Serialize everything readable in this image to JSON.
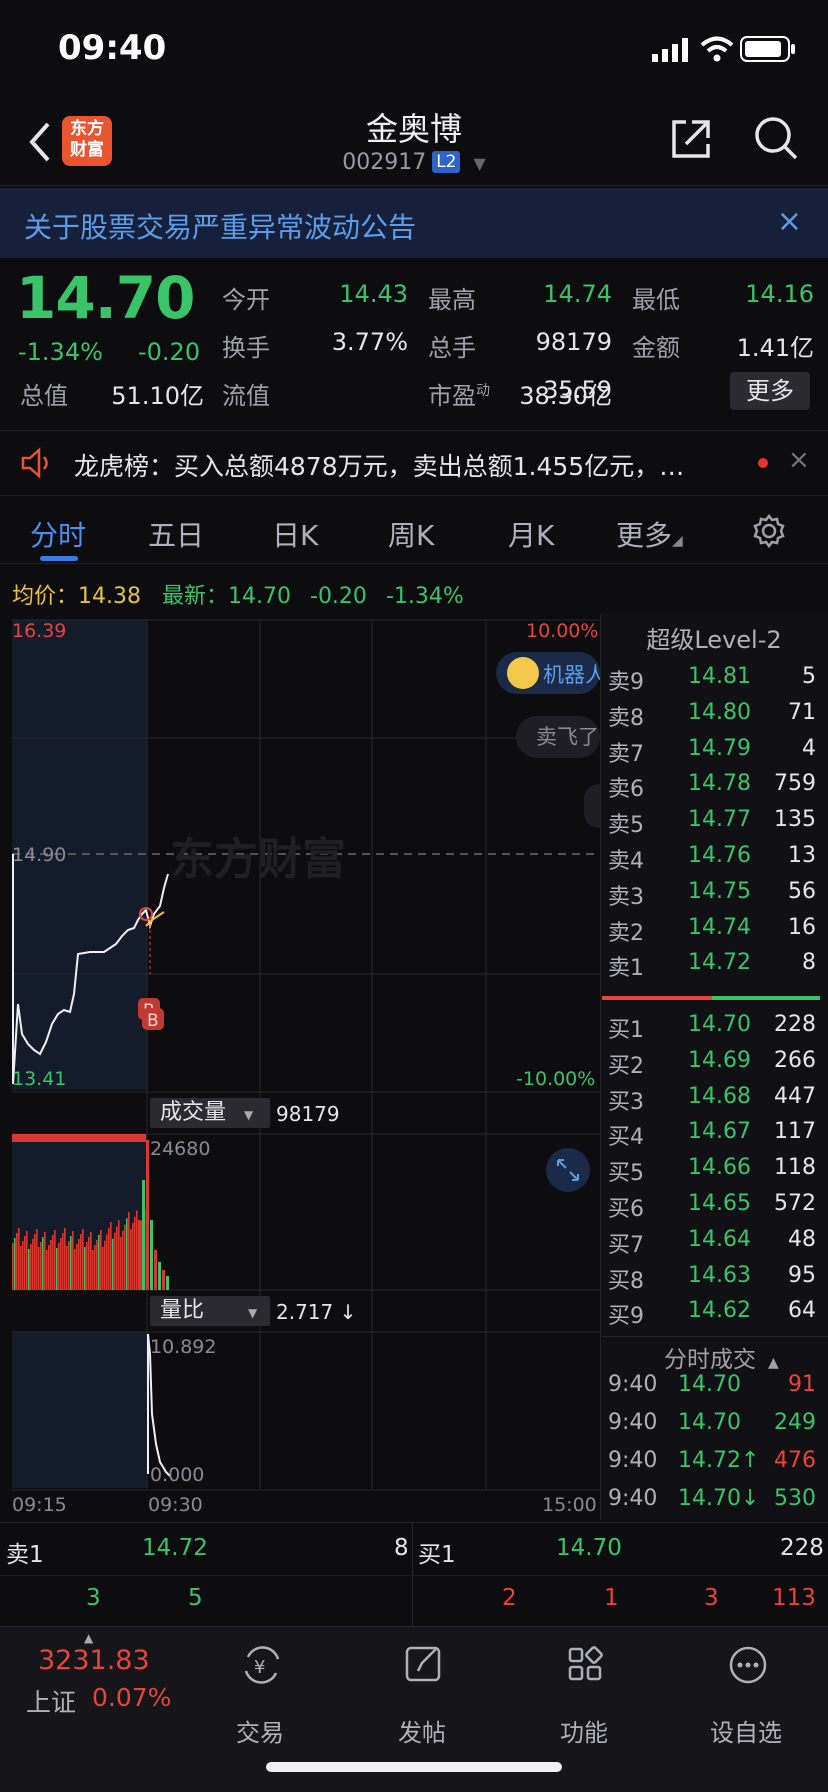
{
  "status": {
    "time": "09:40"
  },
  "header": {
    "logo_text_1": "东方",
    "logo_text_2": "财富",
    "stock_name": "金奥博",
    "stock_code": "002917",
    "level_badge": "L2"
  },
  "notice": {
    "text": "关于股票交易严重异常波动公告",
    "close": "×"
  },
  "quote": {
    "price": "14.70",
    "change_pct": "-1.34%",
    "change_abs": "-0.20",
    "fields": [
      {
        "label": "今开",
        "value": "14.43",
        "color": "green"
      },
      {
        "label": "最高",
        "value": "14.74",
        "color": "green"
      },
      {
        "label": "最低",
        "value": "14.16",
        "color": "green"
      },
      {
        "label": "换手",
        "value": "3.77%",
        "color": "white"
      },
      {
        "label": "总手",
        "value": "98179",
        "color": "white"
      },
      {
        "label": "金额",
        "value": "1.41亿",
        "color": "white"
      },
      {
        "label": "总值",
        "value": "51.10亿",
        "color": "white"
      },
      {
        "label": "流值",
        "value": "38.30亿",
        "color": "white"
      },
      {
        "label": "市盈",
        "label_sup": "动",
        "value": "35.59",
        "color": "white"
      }
    ],
    "more_button": "更多"
  },
  "lhb": {
    "text": "龙虎榜：买入总额4878万元，卖出总额1.455亿元，…"
  },
  "tabs": [
    "分时",
    "五日",
    "日K",
    "周K",
    "月K",
    "更多"
  ],
  "avg_line": {
    "avg_label": "均价：",
    "avg_value": "14.38",
    "latest_label": "最新：",
    "latest_value": "14.70",
    "change_abs": "-0.20",
    "change_pct": "-1.34%"
  },
  "chart": {
    "price_top": "16.39",
    "price_bottom": "13.41",
    "price_mid": "14.90",
    "pct_top": "10.00%",
    "pct_bottom": "-10.00%",
    "watermark": "东方财富",
    "robot_label": "机器人",
    "float_btn": "卖飞了",
    "volume_tag": "成交量",
    "volume_value": "98179",
    "volume_max": "24680",
    "ratio_tag": "量比",
    "ratio_value": "2.717 ↓",
    "ratio_max": "10.892",
    "ratio_min": "0.000",
    "time_start": "09:15",
    "time_open": "09:30",
    "time_end": "15:00",
    "marker_b": "B"
  },
  "orderbook": {
    "title": "超级Level-2",
    "asks": [
      {
        "label": "卖9",
        "price": "14.81",
        "vol": "5"
      },
      {
        "label": "卖8",
        "price": "14.80",
        "vol": "71"
      },
      {
        "label": "卖7",
        "price": "14.79",
        "vol": "4"
      },
      {
        "label": "卖6",
        "price": "14.78",
        "vol": "759"
      },
      {
        "label": "卖5",
        "price": "14.77",
        "vol": "135"
      },
      {
        "label": "卖4",
        "price": "14.76",
        "vol": "13"
      },
      {
        "label": "卖3",
        "price": "14.75",
        "vol": "56"
      },
      {
        "label": "卖2",
        "price": "14.74",
        "vol": "16"
      },
      {
        "label": "卖1",
        "price": "14.72",
        "vol": "8"
      }
    ],
    "bids": [
      {
        "label": "买1",
        "price": "14.70",
        "vol": "228"
      },
      {
        "label": "买2",
        "price": "14.69",
        "vol": "266"
      },
      {
        "label": "买3",
        "price": "14.68",
        "vol": "447"
      },
      {
        "label": "买4",
        "price": "14.67",
        "vol": "117"
      },
      {
        "label": "买5",
        "price": "14.66",
        "vol": "118"
      },
      {
        "label": "买6",
        "price": "14.65",
        "vol": "572"
      },
      {
        "label": "买7",
        "price": "14.64",
        "vol": "48"
      },
      {
        "label": "买8",
        "price": "14.63",
        "vol": "95"
      },
      {
        "label": "买9",
        "price": "14.62",
        "vol": "64"
      }
    ],
    "trades_title": "分时成交",
    "trades": [
      {
        "time": "9:40",
        "price": "14.70",
        "vol": "91",
        "vol_color": "red"
      },
      {
        "time": "9:40",
        "price": "14.70",
        "vol": "249",
        "vol_color": "green"
      },
      {
        "time": "9:40",
        "price": "14.72↑",
        "vol": "476",
        "vol_color": "red"
      },
      {
        "time": "9:40",
        "price": "14.70↓",
        "vol": "530",
        "vol_color": "green"
      }
    ]
  },
  "strip": {
    "sell_label": "卖1",
    "sell_price": "14.72",
    "sell_vol": "8",
    "buy_label": "买1",
    "buy_price": "14.70",
    "buy_vol": "228",
    "sell_sub": [
      "3",
      "5"
    ],
    "buy_sub": [
      "2",
      "1",
      "3",
      "113"
    ]
  },
  "nav": {
    "index_value": "3231.83",
    "index_name": "上证",
    "index_change": "0.07%",
    "items": [
      "交易",
      "发帖",
      "功能",
      "设自选"
    ]
  }
}
